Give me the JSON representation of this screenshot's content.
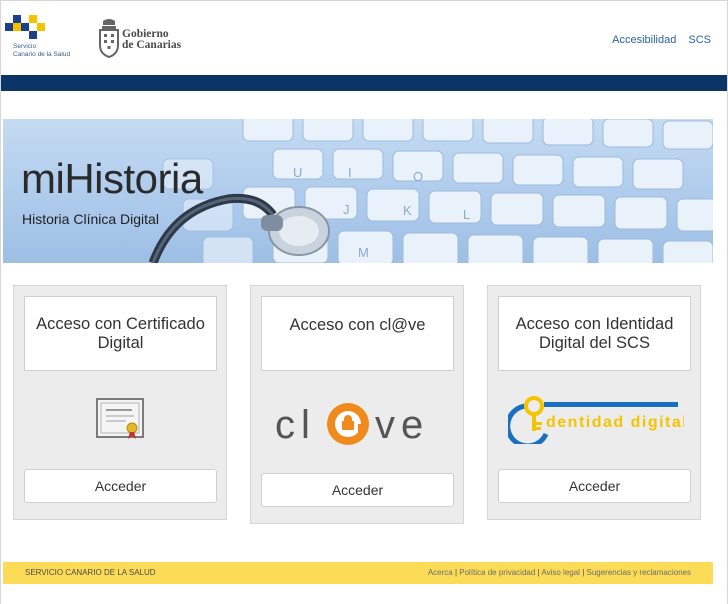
{
  "header": {
    "scs_logo_text": [
      "Servicio",
      "Canario de la Salud"
    ],
    "gob_logo_text": [
      "Gobierno",
      "de Canarias"
    ],
    "links": [
      "Accesibilidad",
      "SCS"
    ]
  },
  "hero": {
    "title": "miHistoria",
    "subtitle": "Historia Clínica Digital"
  },
  "cards": [
    {
      "title": "Acceso con Certificado Digital",
      "image": "certificate-icon",
      "button": "Acceder"
    },
    {
      "title": "Acceso con cl@ve",
      "image_text": "cl@ve",
      "button": "Acceder"
    },
    {
      "title": "Acceso con Identidad Digital del SCS",
      "image_text": "dentidad digital",
      "button": "Acceder"
    }
  ],
  "footer": {
    "left": "SERVICIO CANARIO DE LA SALUD",
    "links": [
      "Acerca",
      "Política de privacidad",
      "Aviso legal",
      "Sugerencias y reclamaciones"
    ],
    "separator": "|"
  },
  "colors": {
    "navy_bar": "#0b3567",
    "link_blue": "#2a64a8",
    "footer_yellow": "#fcdc57",
    "clave_orange": "#f08a1c",
    "identity_blue": "#1a6fc0",
    "identity_yellow": "#f5c400"
  }
}
